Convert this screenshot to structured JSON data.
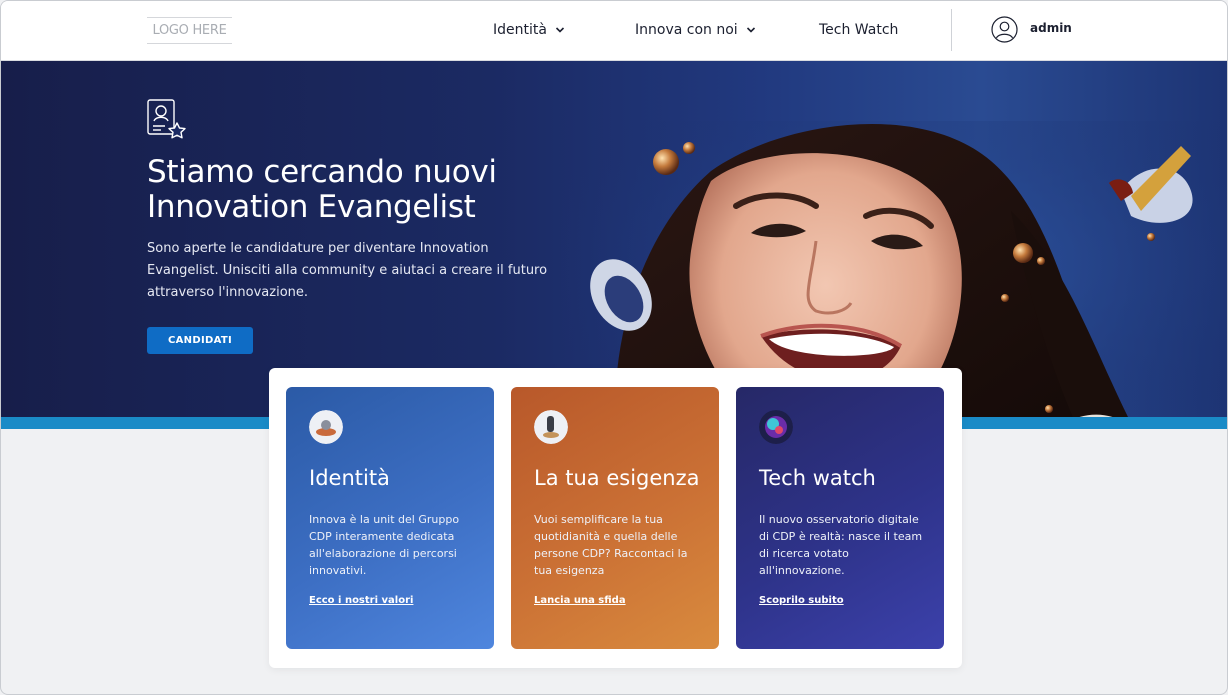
{
  "header": {
    "logo": "LOGO HERE",
    "nav": [
      {
        "label": "Identità"
      },
      {
        "label": "Innova con noi"
      },
      {
        "label": "Tech Watch"
      }
    ],
    "user": "admin"
  },
  "hero": {
    "title": "Stiamo cercando nuovi Innovation Evangelist",
    "text": "Sono aperte le candidature per diventare Innovation Evangelist. Unisciti alla community e aiutaci a creare il futuro attraverso l'innovazione.",
    "button": "CANDIDATI"
  },
  "cards": [
    {
      "title": "Identità",
      "description": "Innova è la unit del Gruppo CDP interamente dedicata all'elaborazione di percorsi innovativi.",
      "link": "Ecco i nostri valori"
    },
    {
      "title": "La tua esigenza",
      "description": "Vuoi semplificare la tua quotidianità e quella delle persone CDP? Raccontaci la tua esigenza",
      "link": "Lancia una sfida"
    },
    {
      "title": "Tech watch",
      "description": "Il nuovo osservatorio digitale di CDP è realtà: nasce il team di ricerca votato all'innovazione.",
      "link": "Scoprilo subito"
    }
  ],
  "colors": {
    "hero_bg": "#1b2a63",
    "strip": "#1a8bc7",
    "button": "#0f6cc5",
    "card_blue": "#3d6fc4",
    "card_orange": "#cb7135",
    "card_indigo": "#2e338a"
  }
}
